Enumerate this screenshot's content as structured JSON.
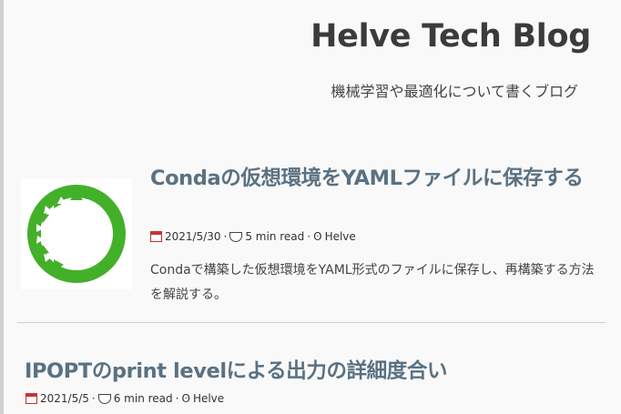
{
  "site": {
    "title": "Helve Tech Blog",
    "subtitle": "機械学習や最適化について書くブログ"
  },
  "posts": [
    {
      "title": "Condaの仮想環境をYAMLファイルに保存する",
      "date": "2021/5/30",
      "read_time": "5 min read",
      "author": "Helve",
      "excerpt": "Condaで構築した仮想環境をYAML形式のファイルに保存し、再構築する方法を解説する。",
      "thumbnail_icon": "anaconda-logo-icon"
    },
    {
      "title": "IPOPTのprint levelによる出力の詳細度合い",
      "date": "2021/5/5",
      "read_time": "6 min read",
      "author": "Helve"
    }
  ],
  "meta_separator": "·",
  "colors": {
    "title": "#3b3b3b",
    "post_title": "#5a7182",
    "background": "#f9f9f9",
    "anaconda_green": "#43b02a"
  }
}
